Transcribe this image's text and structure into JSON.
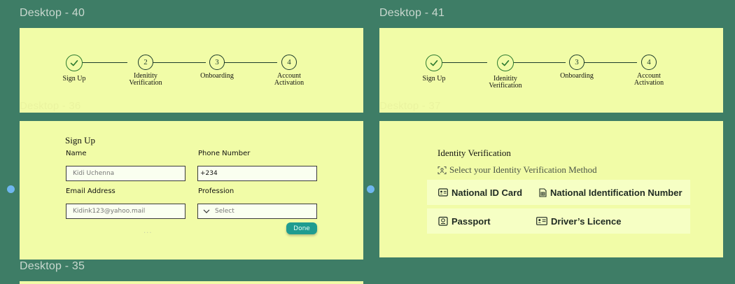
{
  "frames": {
    "d40": "Desktop - 40",
    "d41": "Desktop - 41",
    "d36": "Desktop - 36",
    "d37": "Desktop - 37",
    "d35": "Desktop - 35"
  },
  "stepper": {
    "step1": {
      "label": "Sign Up"
    },
    "step2": {
      "num": "2",
      "line1": "Idenitity",
      "line2": "Verification"
    },
    "step3": {
      "num": "3",
      "label": "Onboarding"
    },
    "step4": {
      "num": "4",
      "line1": "Account",
      "line2": "Activation"
    }
  },
  "signup": {
    "title": "Sign Up",
    "name_label": "Name",
    "name_placeholder": "Kidi Uchenna",
    "phone_label": "Phone Number",
    "phone_value": "+234",
    "email_label": "Email Address",
    "email_placeholder": "Kidink123@yahoo.mail",
    "profession_label": "Profession",
    "profession_placeholder": "Select",
    "done": "Done",
    "dots": "..."
  },
  "identity": {
    "title": "Identity Verification",
    "subtitle": "Select your Identity Verification Method",
    "options": {
      "national_id": "National ID Card",
      "nin": "National Identification Number",
      "passport": "Passport",
      "drivers": "Driver’s Licence"
    }
  },
  "colors": {
    "canvas": "#3e7d66",
    "frame": "#f1fca7",
    "accent": "#1f9c90",
    "check": "#2d7a2f"
  }
}
